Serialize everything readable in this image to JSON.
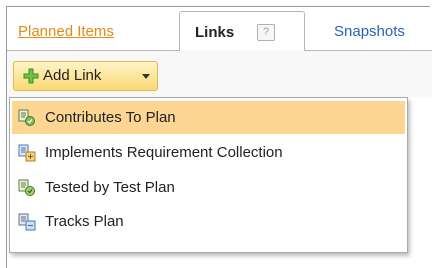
{
  "tabs": {
    "planned_items": "Planned Items",
    "links": "Links",
    "links_help": "?",
    "snapshots": "Snapshots"
  },
  "toolbar": {
    "add_link_label": "Add Link"
  },
  "menu": {
    "items": [
      {
        "label": "Contributes To Plan",
        "icon": "plan-link-icon",
        "highlighted": true
      },
      {
        "label": "Implements Requirement Collection",
        "icon": "requirement-link-icon",
        "highlighted": false
      },
      {
        "label": "Tested by Test Plan",
        "icon": "test-plan-link-icon",
        "highlighted": false
      },
      {
        "label": "Tracks Plan",
        "icon": "tracks-plan-link-icon",
        "highlighted": false
      }
    ]
  },
  "colors": {
    "link_orange": "#e48a17",
    "link_blue": "#2b63b8",
    "highlight": "#fcd692"
  }
}
